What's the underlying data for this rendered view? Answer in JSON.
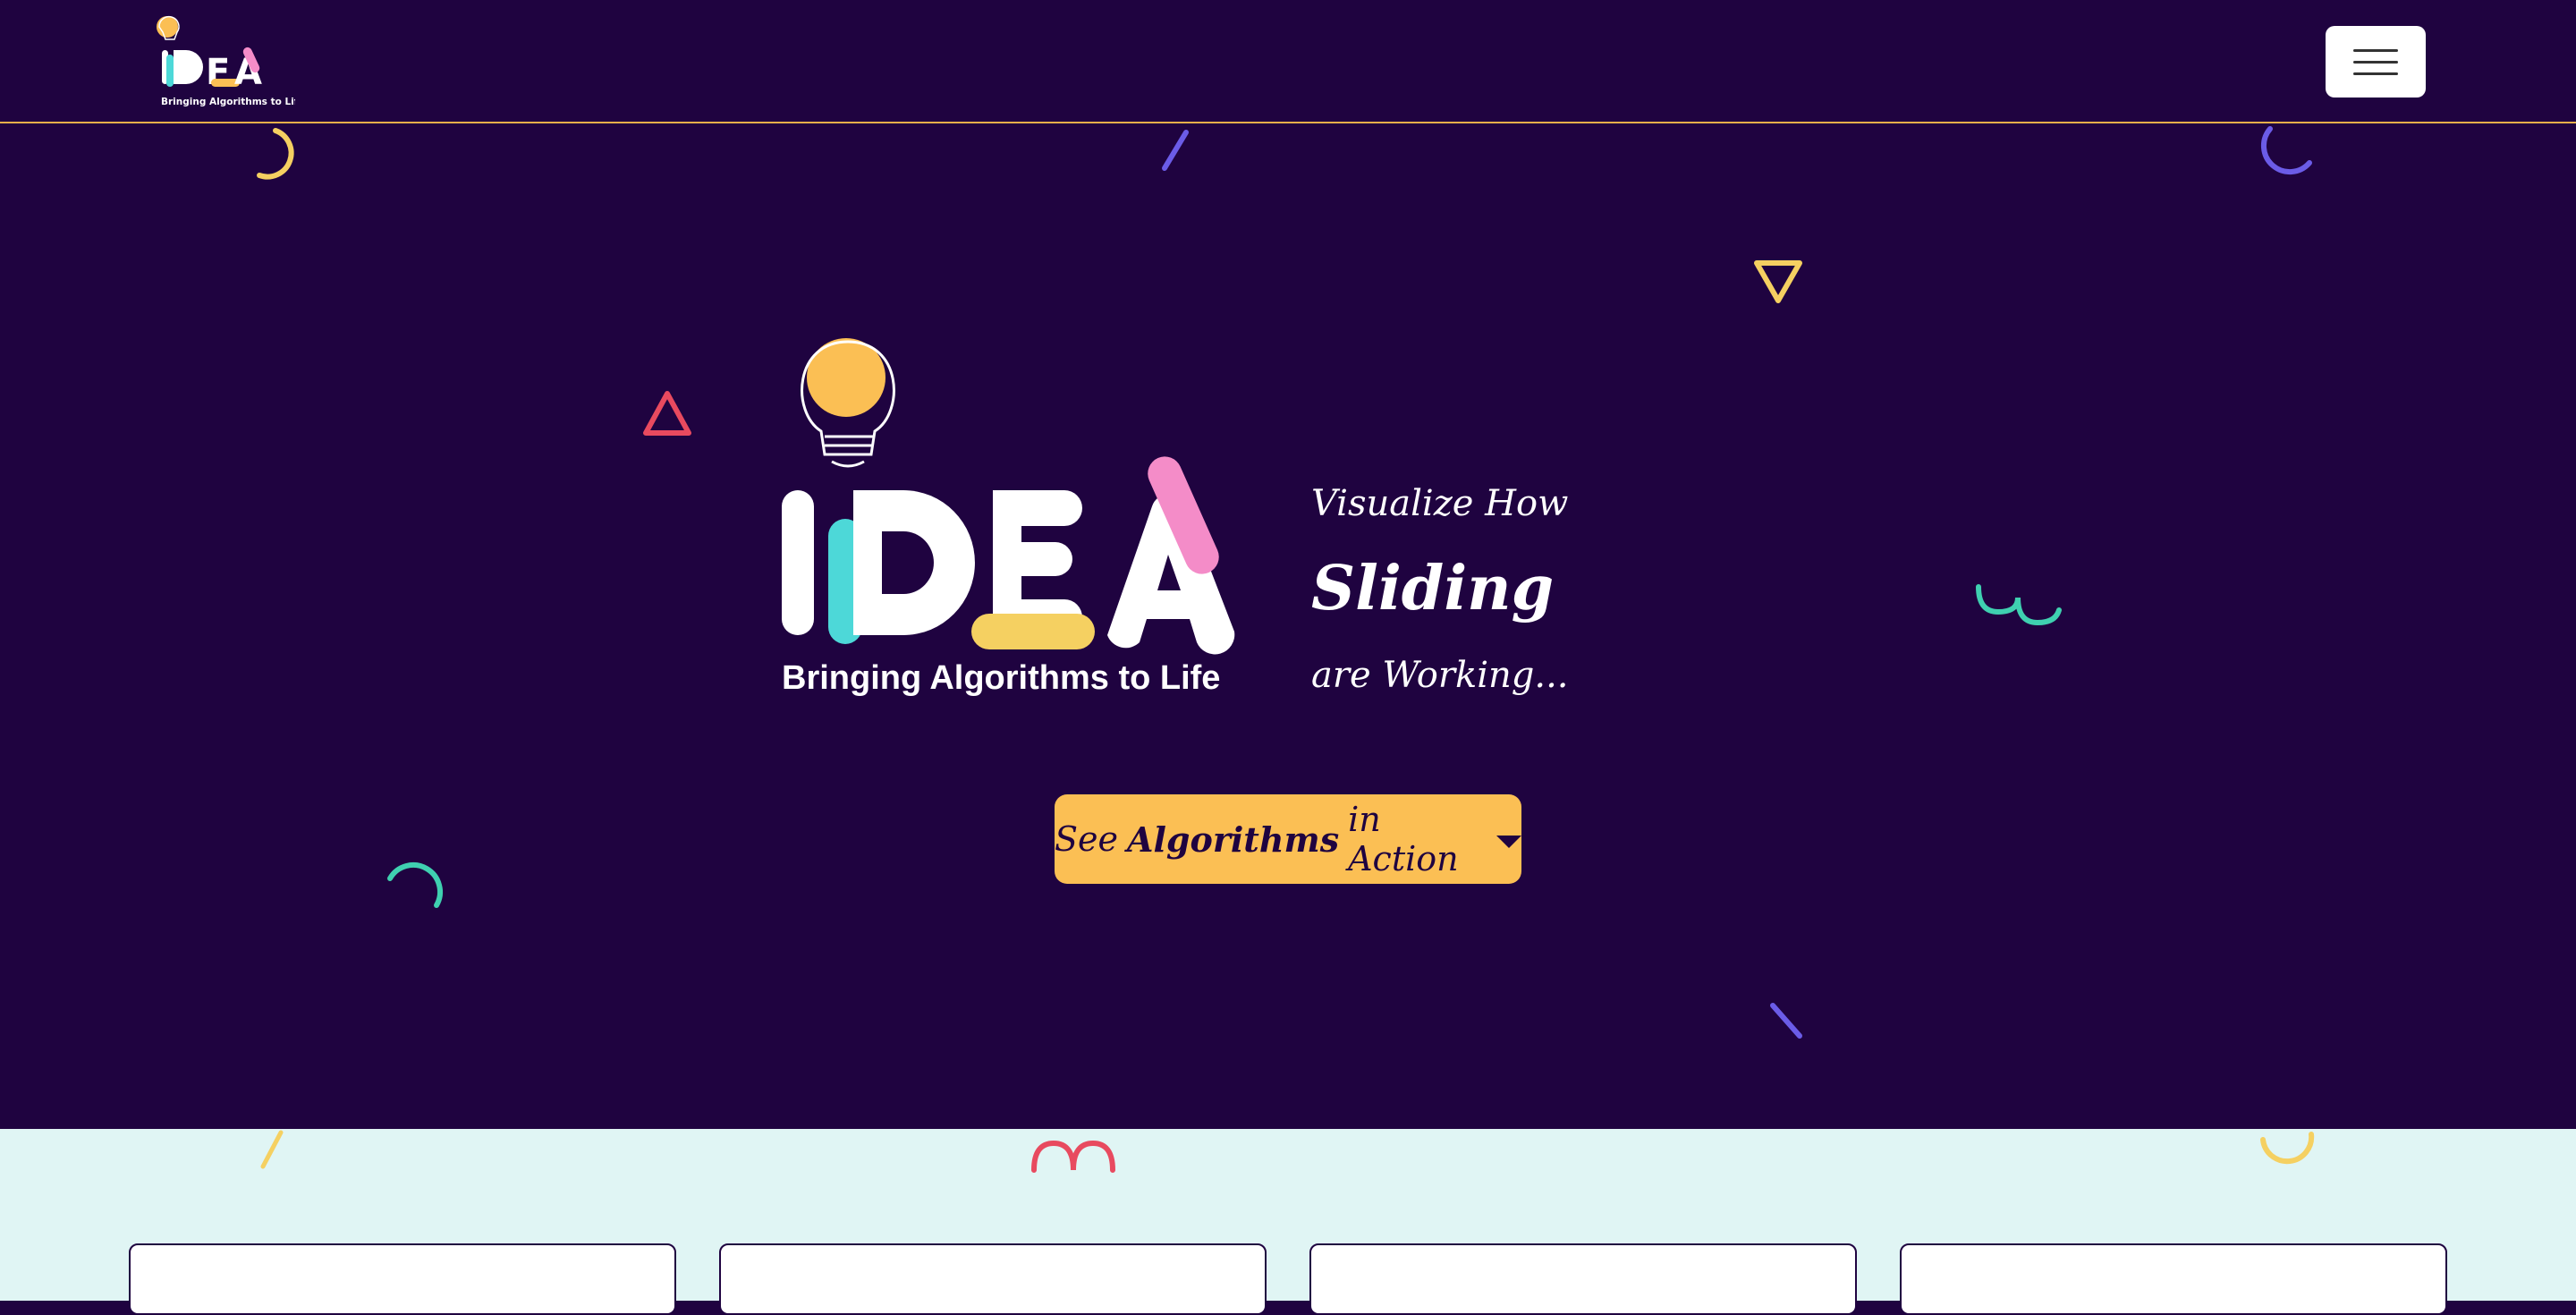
{
  "navbar": {
    "logo": {
      "word": "IDEA",
      "tagline": "Bringing Algorithms to Life"
    },
    "menu_icon": "hamburger-icon"
  },
  "hero": {
    "logo": {
      "word": "IDEA",
      "tagline": "Bringing Algorithms to Life"
    },
    "tagline": {
      "line1": "Visualize How",
      "line2": "Sliding",
      "line3": "are Working..."
    },
    "cta": {
      "part1": "See",
      "part2": "Algorithms",
      "part3": "in Action",
      "icon": "caret-down-icon"
    }
  },
  "colors": {
    "background": "#1f0340",
    "accent_yellow": "#fbbf54",
    "accent_teal": "#4dd8d8",
    "accent_pink": "#f48cc8",
    "lower_bg": "#e0f5f4"
  },
  "cards": [
    {},
    {},
    {},
    {}
  ]
}
